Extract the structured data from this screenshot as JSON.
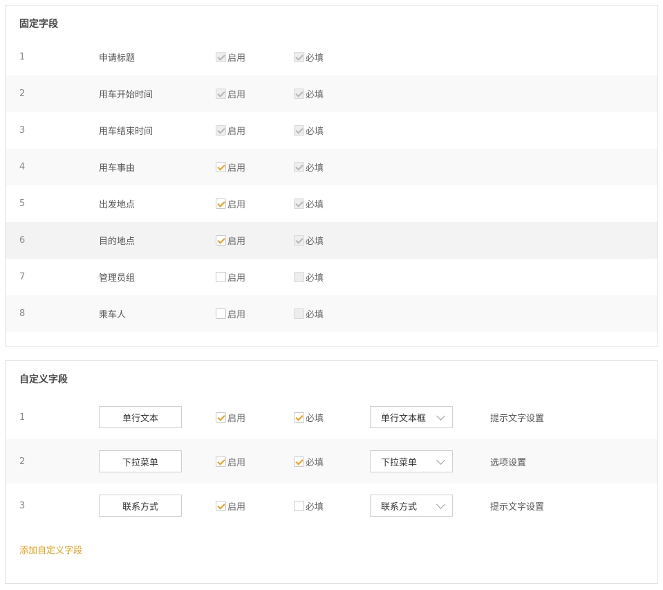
{
  "fixed": {
    "title": "固定字段",
    "enable_label": "启用",
    "required_label": "必填",
    "rows": [
      {
        "index": "1",
        "name": "申请标题",
        "enabled": true,
        "enabled_disabled": true,
        "required": true,
        "required_disabled": true
      },
      {
        "index": "2",
        "name": "用车开始时间",
        "enabled": true,
        "enabled_disabled": true,
        "required": true,
        "required_disabled": true
      },
      {
        "index": "3",
        "name": "用车结束时间",
        "enabled": true,
        "enabled_disabled": true,
        "required": true,
        "required_disabled": true
      },
      {
        "index": "4",
        "name": "用车事由",
        "enabled": true,
        "enabled_disabled": false,
        "required": true,
        "required_disabled": true
      },
      {
        "index": "5",
        "name": "出发地点",
        "enabled": true,
        "enabled_disabled": false,
        "required": true,
        "required_disabled": true
      },
      {
        "index": "6",
        "name": "目的地点",
        "enabled": true,
        "enabled_disabled": false,
        "required": true,
        "required_disabled": true
      },
      {
        "index": "7",
        "name": "管理员组",
        "enabled": false,
        "enabled_disabled": false,
        "required": false,
        "required_disabled": true
      },
      {
        "index": "8",
        "name": "乘车人",
        "enabled": false,
        "enabled_disabled": false,
        "required": false,
        "required_disabled": true
      }
    ]
  },
  "custom": {
    "title": "自定义字段",
    "enable_label": "启用",
    "required_label": "必填",
    "rows": [
      {
        "index": "1",
        "name": "单行文本",
        "enabled": true,
        "required": true,
        "type": "单行文本框",
        "link": "提示文字设置"
      },
      {
        "index": "2",
        "name": "下拉菜单",
        "enabled": true,
        "required": true,
        "type": "下拉菜单",
        "link": "选项设置"
      },
      {
        "index": "3",
        "name": "联系方式",
        "enabled": true,
        "required": false,
        "type": "联系方式",
        "link": "提示文字设置"
      }
    ],
    "add_label": "添加自定义字段"
  },
  "colors": {
    "accent": "#f39c12",
    "border": "#e1e1e1",
    "stripe": "#f9f9f9"
  },
  "icons": {
    "checkbox": "checkbox-icon",
    "dropdown": "chevron-down-icon"
  }
}
